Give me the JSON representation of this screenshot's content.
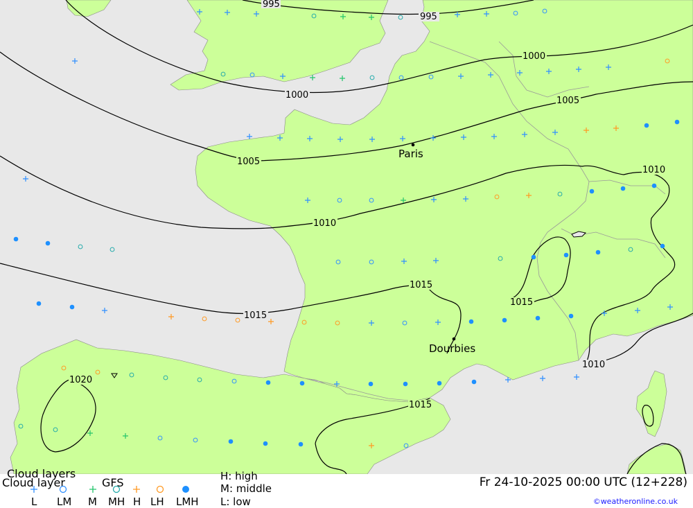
{
  "map": {
    "colors": {
      "sea": "#e8e8e8",
      "land": "#ccff99",
      "isobar": "#000000",
      "border": "#999999"
    },
    "isobar_labels": [
      "995",
      "995",
      "1000",
      "1000",
      "1005",
      "1005",
      "1010",
      "1010",
      "1010",
      "1015",
      "1015",
      "1015",
      "1015",
      "1020"
    ],
    "cities": [
      "Paris",
      "Dourbies"
    ],
    "symbol_types": {
      "L": "plus-blue",
      "LM": "ring-blue",
      "M": "plus-green",
      "MH": "ring-teal",
      "H": "plus-orange",
      "LH": "ring-orange",
      "LMH": "dot-blue"
    },
    "symbol_colors": {
      "L": "#2f8fff",
      "LM": "#2f8fff",
      "M": "#22c46a",
      "MH": "#22aaaa",
      "H": "#ff9922",
      "LH": "#ff9922",
      "LMH": "#1e90ff"
    }
  },
  "legend": {
    "title": "Cloud layers",
    "subtitle": "Cloud layer",
    "model": "GFS",
    "codes": [
      "L",
      "LM",
      "M",
      "MH",
      "H",
      "LH",
      "LMH"
    ],
    "key_high": "H: high",
    "key_middle": "M: middle",
    "key_low": "L: low",
    "datetime": "Fr 24-10-2025 00:00 UTC (12+228)",
    "credit": "©weatheronline.co.uk"
  }
}
